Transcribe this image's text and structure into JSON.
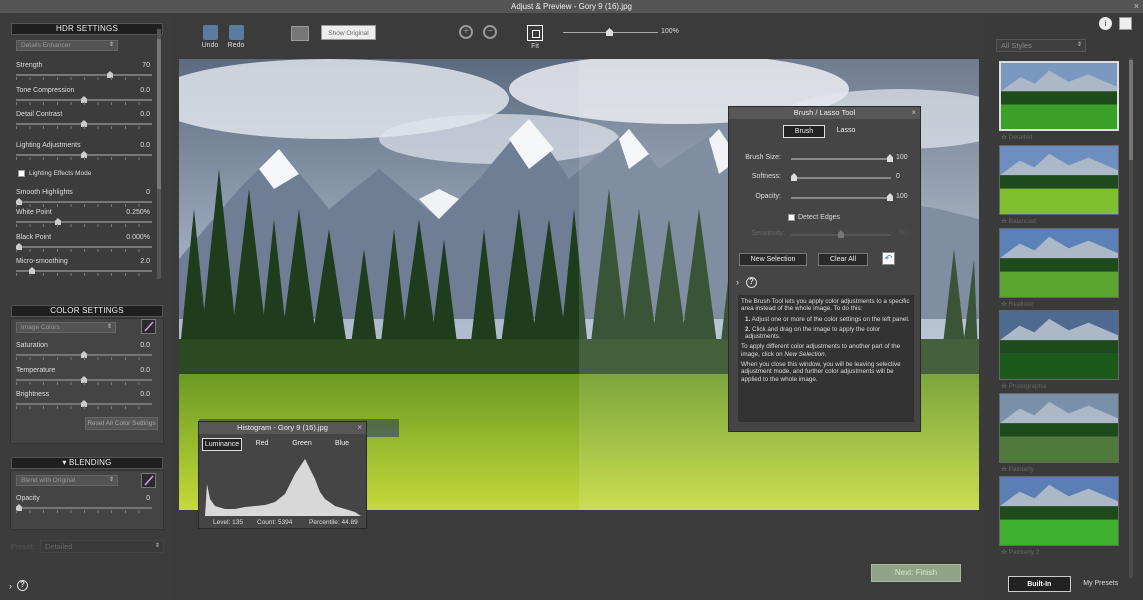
{
  "window": {
    "title": "Adjust & Preview - Gory 9 (16).jpg",
    "close": "×"
  },
  "hdr": {
    "header": "HDR SETTINGS",
    "preset_dropdown": "Details Enhancer",
    "sliders": [
      {
        "label": "Strength",
        "value": "70",
        "level": 0.7
      },
      {
        "label": "Tone Compression",
        "value": "0.0",
        "level": 0.5
      },
      {
        "label": "Detail Contrast",
        "value": "0.0",
        "level": 0.5
      },
      {
        "label": "Lighting Adjustments",
        "value": "0.0",
        "level": 0.5
      },
      {
        "label": "Smooth Highlights",
        "value": "0",
        "level": 0.0
      },
      {
        "label": "White Point",
        "value": "0.250%",
        "level": 0.3
      },
      {
        "label": "Black Point",
        "value": "0.000%",
        "level": 0.0
      },
      {
        "label": "Micro-smoothing",
        "value": "2.0",
        "level": 0.1
      }
    ],
    "lighting_effects_mode": "Lighting Effects Mode"
  },
  "color": {
    "header": "COLOR SETTINGS",
    "dropdown": "Image Colors",
    "sliders": [
      {
        "label": "Saturation",
        "value": "0.0",
        "level": 0.5
      },
      {
        "label": "Temperature",
        "value": "0.0",
        "level": 0.5
      },
      {
        "label": "Brightness",
        "value": "0.0",
        "level": 0.5
      }
    ],
    "reset": "Reset All Color Settings"
  },
  "blending": {
    "header": "▾ BLENDING",
    "dropdown": "Blend with Original",
    "opacity_label": "Opacity",
    "opacity_value": "0",
    "opacity_level": 0.0
  },
  "preset": {
    "label": "Preset:",
    "value": "Detailed"
  },
  "toolbar": {
    "undo": "Undo",
    "redo": "Redo",
    "show_original": "Show Original",
    "fit": "Fit",
    "zoom": "100%",
    "zoom_level": 0.5
  },
  "histogram": {
    "title": "Histogram - Gory 9 (16).jpg",
    "tabs": [
      "Luminance",
      "Red",
      "Green",
      "Blue"
    ],
    "level": "Level: 135",
    "count": "Count: 5394",
    "percentile": "Percentile: 44.89"
  },
  "brush": {
    "title": "Brush / Lasso Tool",
    "tabs": [
      "Brush",
      "Lasso"
    ],
    "sliders": [
      {
        "label": "Brush Size:",
        "value": "100",
        "level": 1.0
      },
      {
        "label": "Softness:",
        "value": "0",
        "level": 0.0
      },
      {
        "label": "Opacity:",
        "value": "100",
        "level": 1.0
      }
    ],
    "detect_edges": "Detect Edges",
    "sensitivity": "Sensitivity:",
    "sensitivity_value": "50",
    "new_selection": "New Selection",
    "clear_all": "Clear All",
    "help_intro": "The Brush Tool lets you apply color adjustments to a specific area instead of the whole image. To do this:",
    "help_step1_num": "1.",
    "help_step1": "Adjust one or more of the color settings on the left panel.",
    "help_step2_num": "2.",
    "help_step2": "Click and drag on the image to apply the color adjustments.",
    "help_p2_start": "To apply different color adjustments to another part of the image, click on",
    "help_p2_em": "New Selection",
    "help_p3": "When you close this window, you will be leaving selective adjustment mode, and further color adjustments will be applied to the whole image."
  },
  "styles": {
    "dropdown": "All Styles",
    "items": [
      "Detailed",
      "Balanced",
      "Realistic",
      "Photographic",
      "Painterly",
      "Painterly 2"
    ],
    "tabs": [
      "Built-In",
      "My Presets"
    ]
  },
  "next": "Next: Finish",
  "colors": {
    "accent_green": "#8fa386",
    "panel_bg": "#3c3c3c"
  }
}
